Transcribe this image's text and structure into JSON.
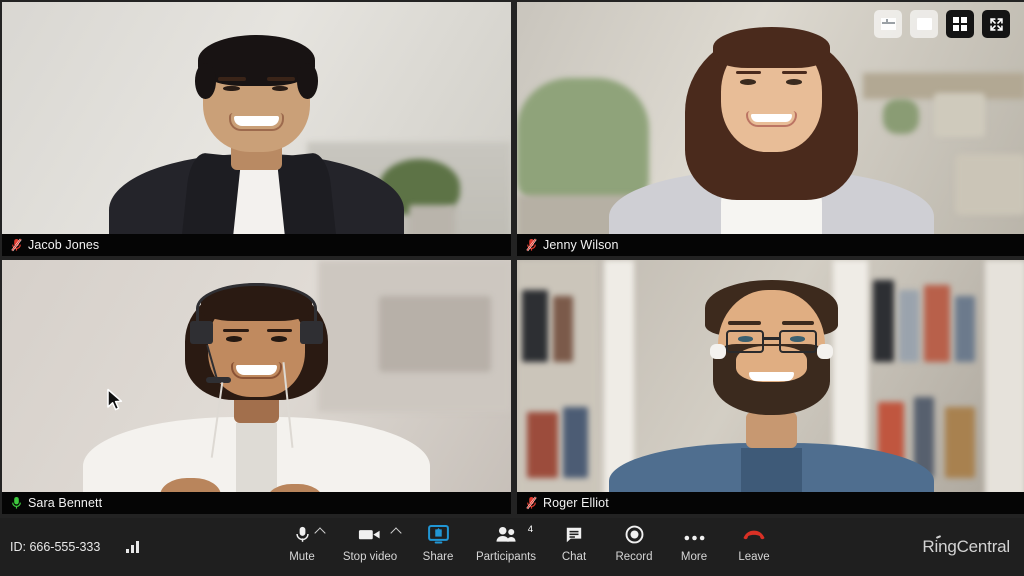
{
  "app": {
    "brand": "RingCentral"
  },
  "meeting": {
    "id_label": "ID: 666-555-333",
    "signal_icon": "signal-bars-icon"
  },
  "view_modes": [
    {
      "name": "filmstrip-view",
      "icon": "filmstrip-layout-icon",
      "active": false
    },
    {
      "name": "speaker-view",
      "icon": "speaker-layout-icon",
      "active": false
    },
    {
      "name": "gallery-view",
      "icon": "grid-layout-icon",
      "active": true
    },
    {
      "name": "fullscreen",
      "icon": "fullscreen-icon",
      "active": false
    }
  ],
  "participants": [
    {
      "name": "Jacob Jones",
      "muted": true,
      "speaking": false,
      "mic_icon": "mic-muted-icon"
    },
    {
      "name": "Jenny Wilson",
      "muted": true,
      "speaking": false,
      "mic_icon": "mic-muted-icon"
    },
    {
      "name": "Sara Bennett",
      "muted": false,
      "speaking": true,
      "mic_icon": "mic-on-icon"
    },
    {
      "name": "Roger Elliot",
      "muted": true,
      "speaking": false,
      "mic_icon": "mic-muted-icon"
    }
  ],
  "toolbar": {
    "mute": {
      "label": "Mute",
      "icon": "microphone-icon",
      "has_menu": true
    },
    "stop_video": {
      "label": "Stop video",
      "icon": "video-camera-icon",
      "has_menu": true
    },
    "share": {
      "label": "Share",
      "icon": "share-screen-icon"
    },
    "participants": {
      "label": "Participants",
      "icon": "participants-icon",
      "count": "4"
    },
    "chat": {
      "label": "Chat",
      "icon": "chat-bubble-icon"
    },
    "record": {
      "label": "Record",
      "icon": "record-icon"
    },
    "more": {
      "label": "More",
      "icon": "more-dots-icon"
    },
    "leave": {
      "label": "Leave",
      "icon": "leave-call-icon"
    }
  },
  "colors": {
    "active_speaker": "#2ecc2e",
    "share_blue": "#2196d4",
    "leave_red": "#d93025",
    "mic_muted_red": "#e03b2f",
    "mic_on_green": "#3ec93e",
    "toolbar_bg": "#1f1f1f"
  }
}
